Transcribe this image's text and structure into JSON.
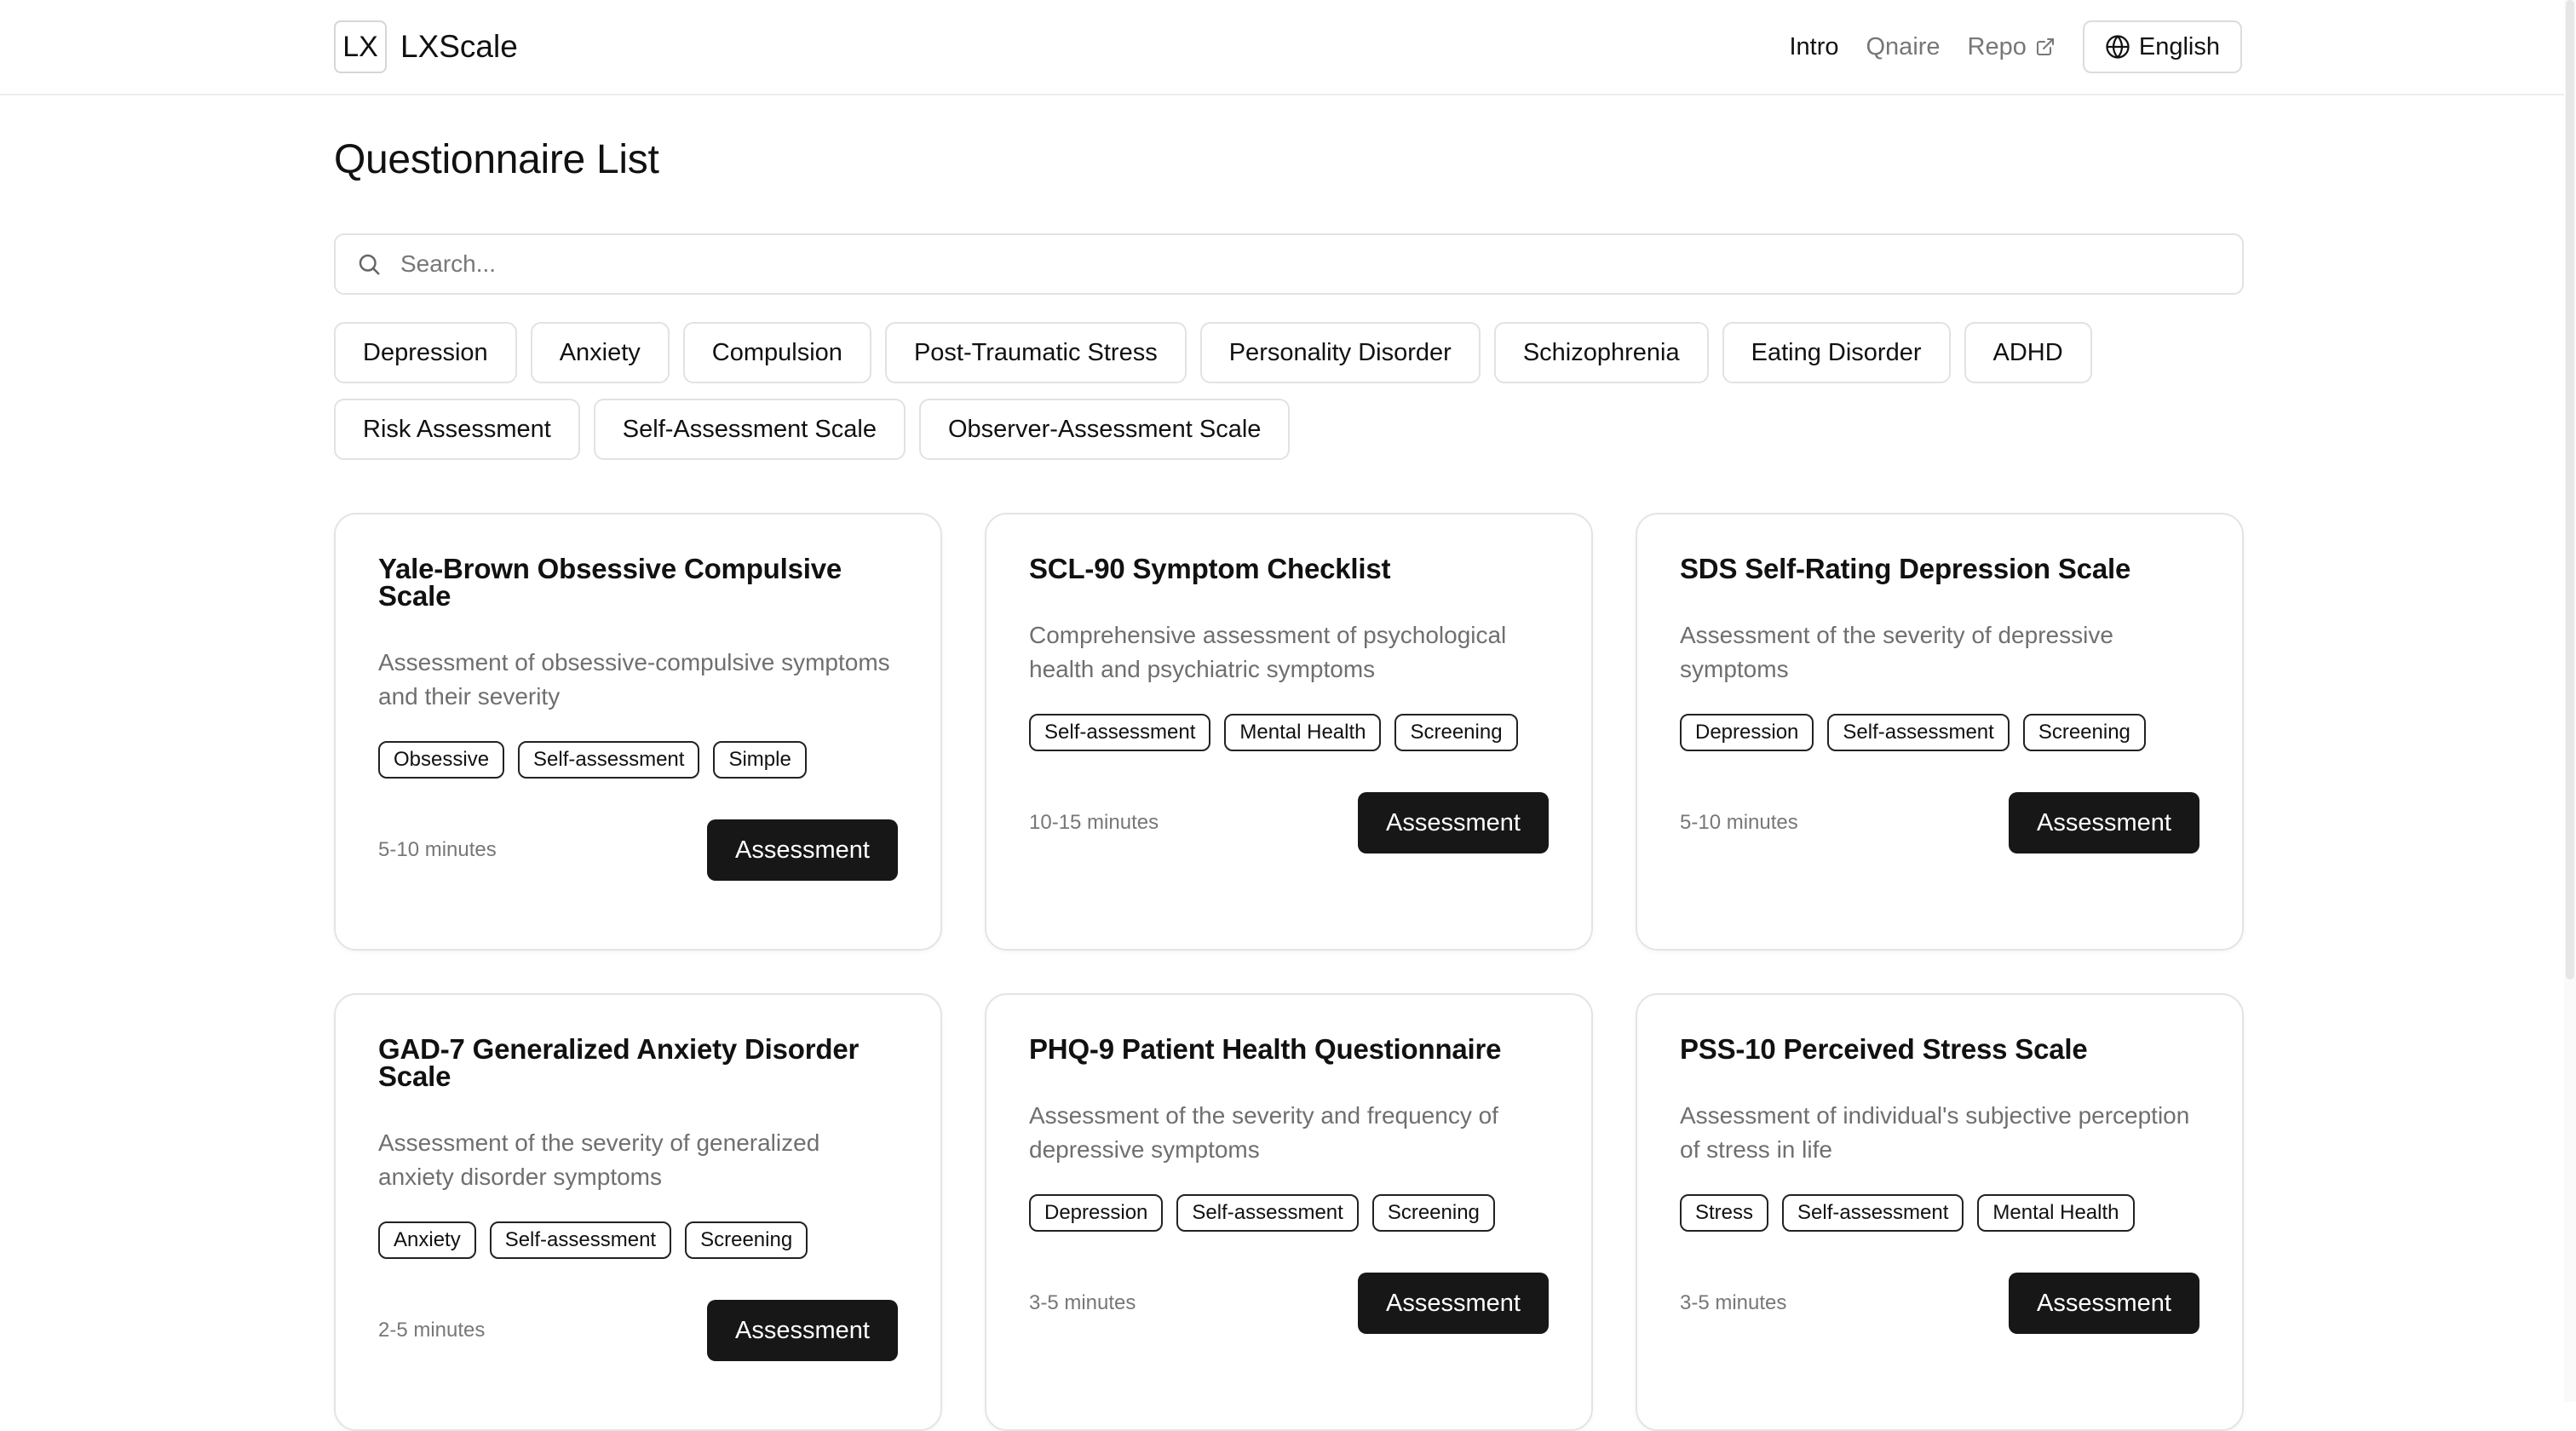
{
  "header": {
    "logo_mark": "LX",
    "logo_text": "LXScale",
    "nav": [
      {
        "label": "Intro",
        "active": true
      },
      {
        "label": "Qnaire",
        "active": false
      },
      {
        "label": "Repo",
        "active": false,
        "icon": "external-link-icon"
      }
    ],
    "language": {
      "label": "English",
      "icon": "globe-icon"
    }
  },
  "page": {
    "title": "Questionnaire List",
    "search_placeholder": "Search...",
    "search_value": ""
  },
  "filters": {
    "row1": [
      "Depression",
      "Anxiety",
      "Compulsion",
      "Post-Traumatic Stress",
      "Personality Disorder",
      "Schizophrenia",
      "Eating Disorder",
      "ADHD"
    ],
    "row2": [
      "Risk Assessment",
      "Self-Assessment Scale",
      "Observer-Assessment Scale"
    ]
  },
  "cards": [
    {
      "title": "Yale-Brown Obsessive Compulsive Scale",
      "description": "Assessment of obsessive-compulsive symptoms and their severity",
      "tags": [
        "Obsessive",
        "Self-assessment",
        "Simple"
      ],
      "duration": "5-10 minutes",
      "button": "Assessment"
    },
    {
      "title": "SCL-90 Symptom Checklist",
      "description": "Comprehensive assessment of psychological health and psychiatric symptoms",
      "tags": [
        "Self-assessment",
        "Mental Health",
        "Screening"
      ],
      "duration": "10-15 minutes",
      "button": "Assessment"
    },
    {
      "title": "SDS Self-Rating Depression Scale",
      "description": "Assessment of the severity of depressive symptoms",
      "tags": [
        "Depression",
        "Self-assessment",
        "Screening"
      ],
      "duration": "5-10 minutes",
      "button": "Assessment"
    },
    {
      "title": "GAD-7 Generalized Anxiety Disorder Scale",
      "description": "Assessment of the severity of generalized anxiety disorder symptoms",
      "tags": [
        "Anxiety",
        "Self-assessment",
        "Screening"
      ],
      "duration": "2-5 minutes",
      "button": "Assessment"
    },
    {
      "title": "PHQ-9 Patient Health Questionnaire",
      "description": "Assessment of the severity and frequency of depressive symptoms",
      "tags": [
        "Depression",
        "Self-assessment",
        "Screening"
      ],
      "duration": "3-5 minutes",
      "button": "Assessment"
    },
    {
      "title": "PSS-10 Perceived Stress Scale",
      "description": "Assessment of individual's subjective perception of stress in life",
      "tags": [
        "Stress",
        "Self-assessment",
        "Mental Health"
      ],
      "duration": "3-5 minutes",
      "button": "Assessment"
    }
  ]
}
